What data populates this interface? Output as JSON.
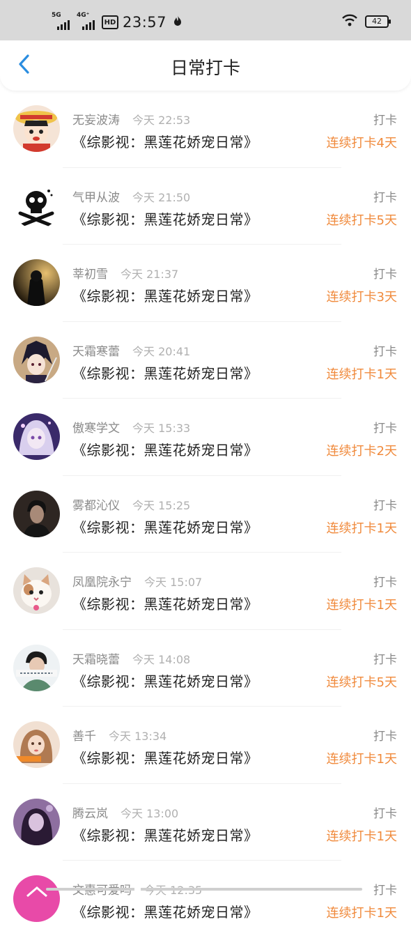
{
  "status_bar": {
    "signal1_tag": "5G",
    "signal2_tag": "4G⁺",
    "hd_label": "HD",
    "time": "23:57",
    "battery": "42"
  },
  "nav": {
    "title": "日常打卡",
    "back_icon": "chevron-left-icon"
  },
  "checkins": [
    {
      "name": "无妄波涛",
      "time": "今天 22:53",
      "book": "《综影视：黑莲花娇宠日常》",
      "action": "打卡",
      "streak": "连续打卡4天"
    },
    {
      "name": "气甲从波",
      "time": "今天 21:50",
      "book": "《综影视：黑莲花娇宠日常》",
      "action": "打卡",
      "streak": "连续打卡5天"
    },
    {
      "name": "莘初雪",
      "time": "今天 21:37",
      "book": "《综影视：黑莲花娇宠日常》",
      "action": "打卡",
      "streak": "连续打卡3天"
    },
    {
      "name": "天霜寒蕾",
      "time": "今天 20:41",
      "book": "《综影视：黑莲花娇宠日常》",
      "action": "打卡",
      "streak": "连续打卡1天"
    },
    {
      "name": "傲寒学文",
      "time": "今天 15:33",
      "book": "《综影视：黑莲花娇宠日常》",
      "action": "打卡",
      "streak": "连续打卡2天"
    },
    {
      "name": "雾都沁仪",
      "time": "今天 15:25",
      "book": "《综影视：黑莲花娇宠日常》",
      "action": "打卡",
      "streak": "连续打卡1天"
    },
    {
      "name": "凤凰院永宁",
      "time": "今天 15:07",
      "book": "《综影视：黑莲花娇宠日常》",
      "action": "打卡",
      "streak": "连续打卡1天"
    },
    {
      "name": "天霜晓蕾",
      "time": "今天 14:08",
      "book": "《综影视：黑莲花娇宠日常》",
      "action": "打卡",
      "streak": "连续打卡5天"
    },
    {
      "name": "善千",
      "time": "今天 13:34",
      "book": "《综影视：黑莲花娇宠日常》",
      "action": "打卡",
      "streak": "连续打卡1天"
    },
    {
      "name": "腾云岚",
      "time": "今天 13:00",
      "book": "《综影视：黑莲花娇宠日常》",
      "action": "打卡",
      "streak": "连续打卡1天"
    },
    {
      "name": "文惠可爱吗",
      "time": "今天 12:35",
      "book": "《综影视：黑莲花娇宠日常》",
      "action": "打卡",
      "streak": "连续打卡1天"
    }
  ],
  "colors": {
    "accent_orange": "#f08a3c",
    "back_blue": "#2a8de0",
    "status_bar_bg": "#d9d9d9"
  }
}
